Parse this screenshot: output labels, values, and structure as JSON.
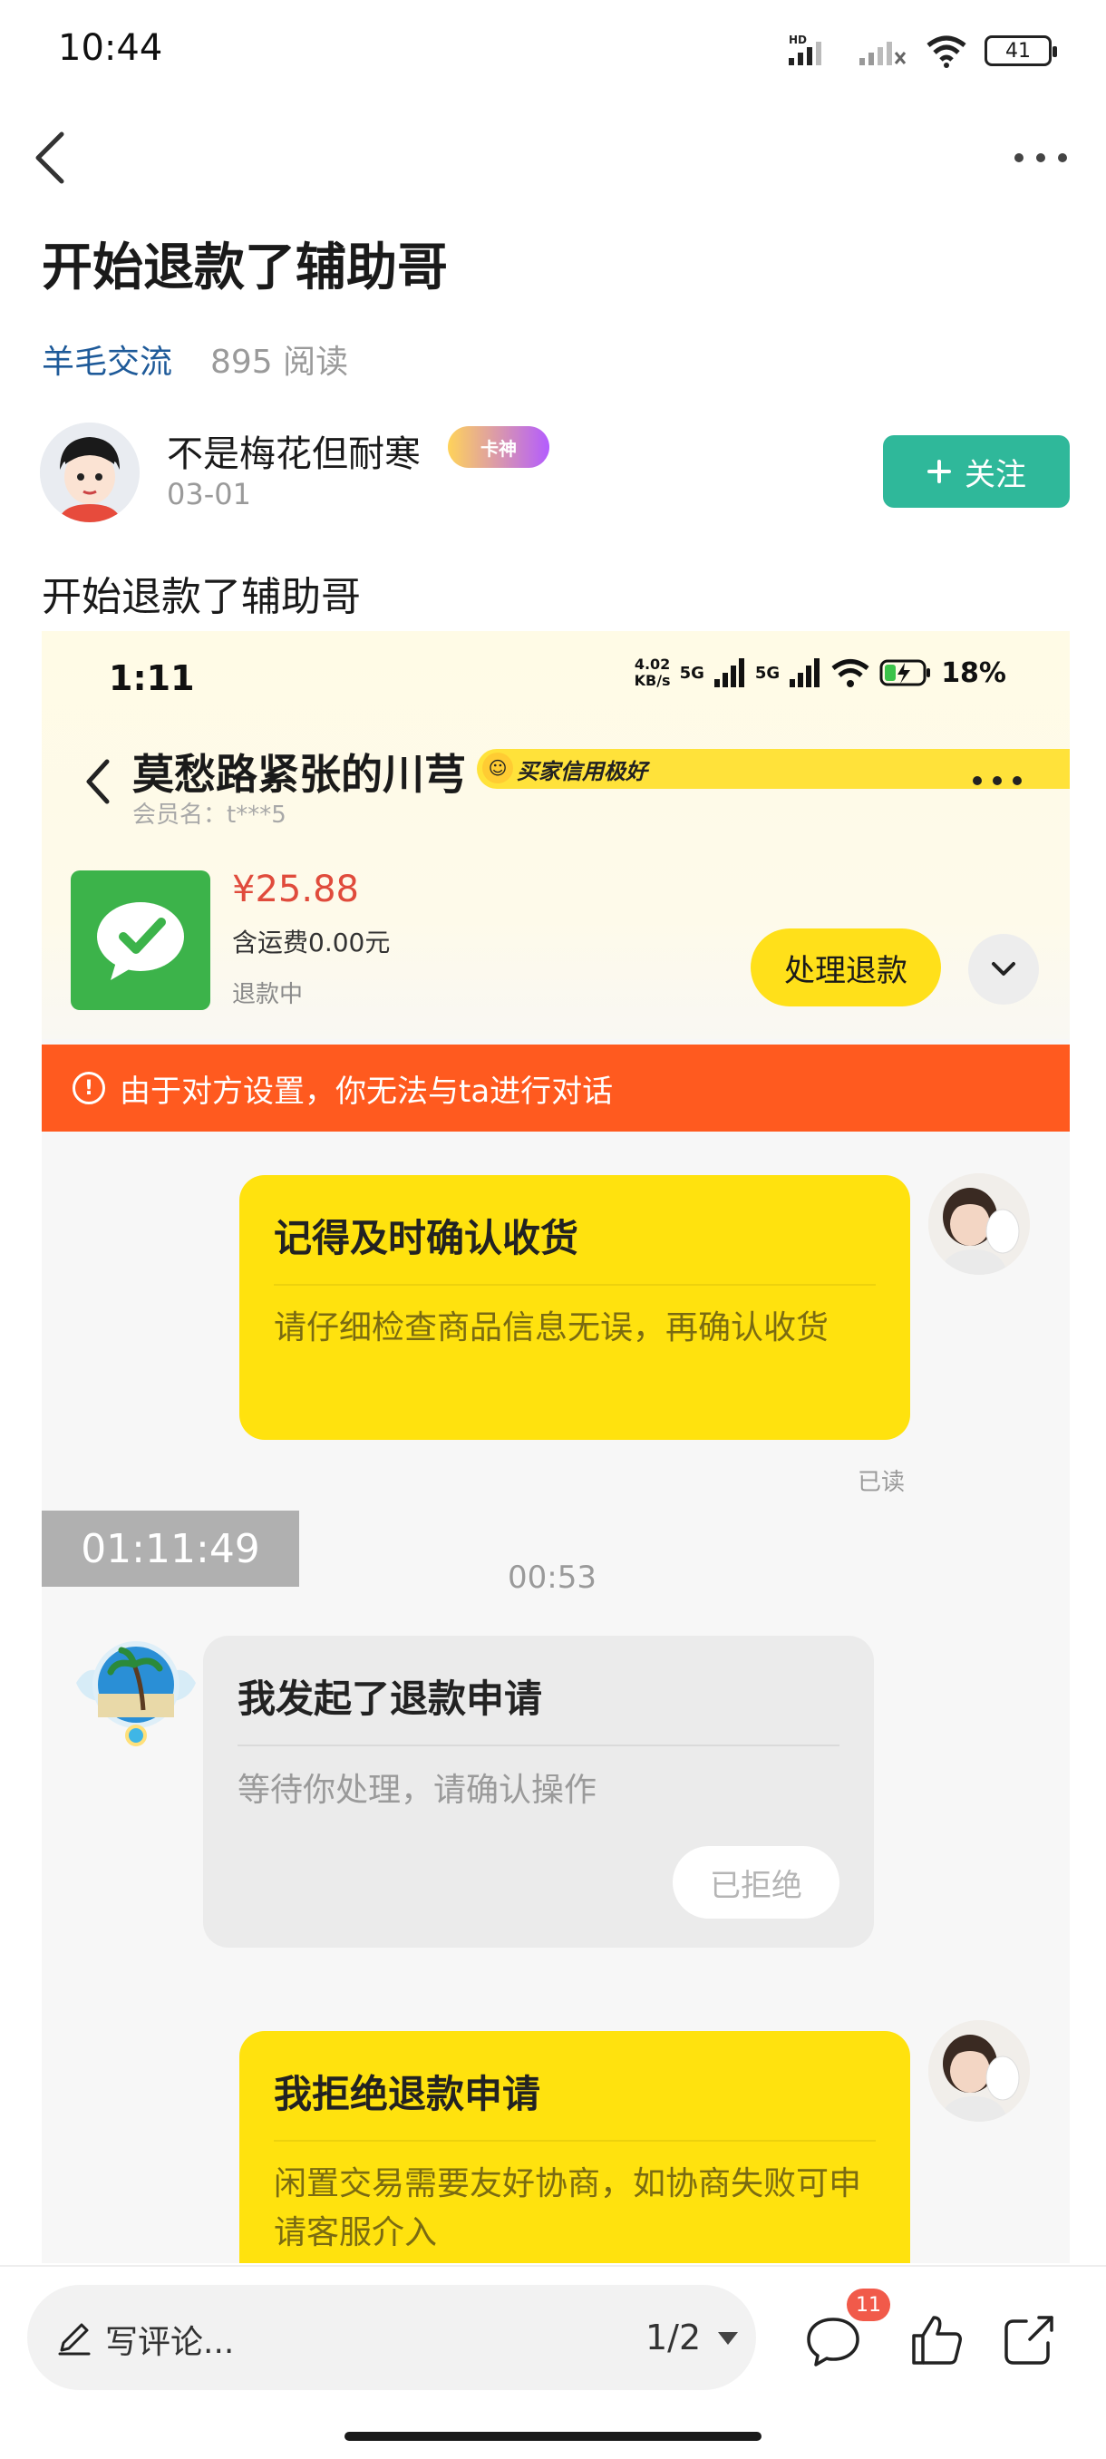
{
  "status_bar": {
    "time": "10:44",
    "battery": "41",
    "signal_label": "HD"
  },
  "header": {
    "title": "开始退款了辅助哥"
  },
  "meta": {
    "channel": "羊毛交流",
    "reads": "895 阅读"
  },
  "author": {
    "name": "不是梅花但耐寒",
    "badge": "卡神",
    "date": "03-01",
    "follow_label": "关注"
  },
  "post": {
    "text": "开始退款了辅助哥"
  },
  "screenshot": {
    "status": {
      "time": "1:11",
      "speed": "4.02",
      "speed_unit": "KB/s",
      "net1": "5G",
      "net2": "5G",
      "battery": "18%"
    },
    "header": {
      "name": "莫愁路紧张的川芎",
      "credit_badge": "买家信用极好",
      "member": "会员名：t***5"
    },
    "product": {
      "price": "¥25.88",
      "shipping": "含运费0.00元",
      "status": "退款中",
      "action": "处理退款"
    },
    "banner": {
      "text": "由于对方设置，你无法与ta进行对话"
    },
    "messages": [
      {
        "title": "记得及时确认收货",
        "body": "请仔细检查商品信息无误，再确认收货",
        "read": "已读"
      },
      {
        "title": "我发起了退款申请",
        "body": "等待你处理，请确认操作",
        "status": "已拒绝"
      },
      {
        "title": "我拒绝退款申请",
        "body": "闲置交易需要友好协商，如协商失败可申请客服介入"
      }
    ],
    "timer": "01:11:49",
    "timestamp": "00:53"
  },
  "bottom_bar": {
    "comment_placeholder": "写评论...",
    "pager": "1/2",
    "comment_count": "11"
  },
  "colors": {
    "accent_green": "#2fb89a",
    "channel_blue": "#1e5a99",
    "chat_yellow": "#ffe20e",
    "banner_orange": "#ff5a1f",
    "price_red": "#e04b3c"
  }
}
